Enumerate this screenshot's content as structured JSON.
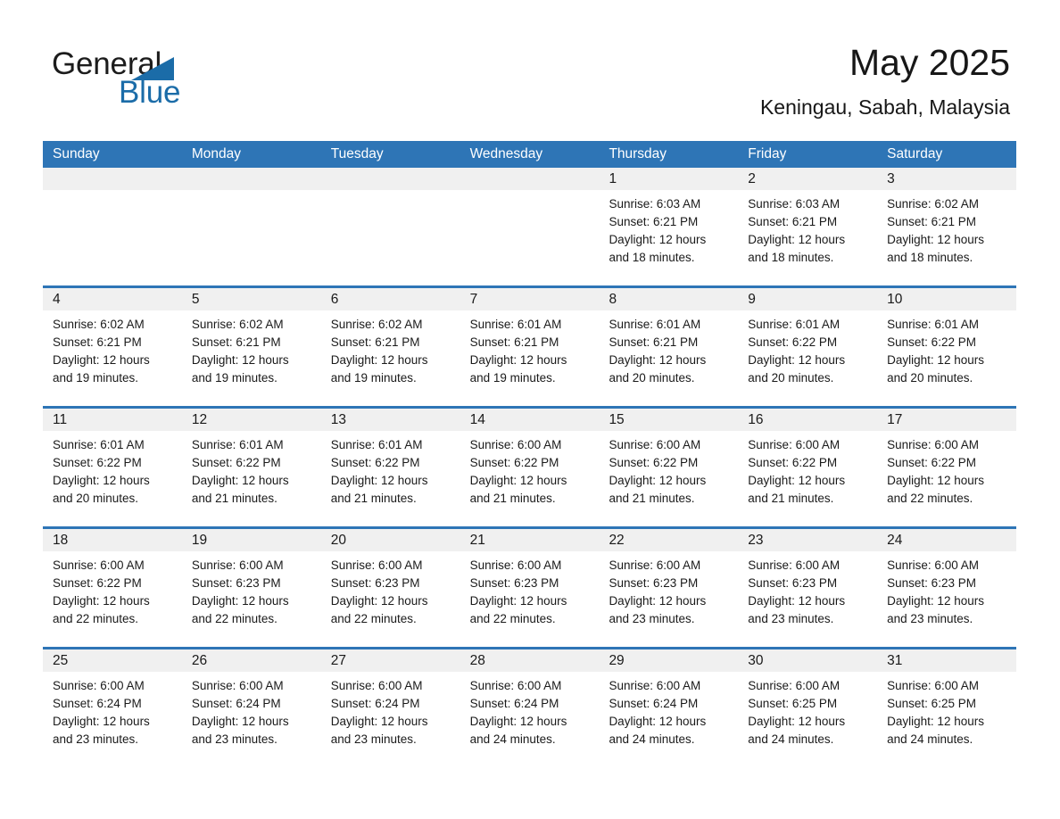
{
  "brand": {
    "line1": "General",
    "line2": "Blue",
    "triangle_color": "#1b6ca8"
  },
  "header": {
    "title": "May 2025",
    "subtitle": "Keningau, Sabah, Malaysia"
  },
  "theme": {
    "header_blue": "#2e75b6",
    "day_band_gray": "#f0f0f0",
    "cell_white": "#ffffff",
    "text": "#1a1a1a"
  },
  "weekdays": [
    "Sunday",
    "Monday",
    "Tuesday",
    "Wednesday",
    "Thursday",
    "Friday",
    "Saturday"
  ],
  "weeks": [
    [
      {
        "day": "",
        "empty": true
      },
      {
        "day": "",
        "empty": true
      },
      {
        "day": "",
        "empty": true
      },
      {
        "day": "",
        "empty": true
      },
      {
        "day": "1",
        "sunrise": "Sunrise: 6:03 AM",
        "sunset": "Sunset: 6:21 PM",
        "daylight1": "Daylight: 12 hours",
        "daylight2": "and 18 minutes."
      },
      {
        "day": "2",
        "sunrise": "Sunrise: 6:03 AM",
        "sunset": "Sunset: 6:21 PM",
        "daylight1": "Daylight: 12 hours",
        "daylight2": "and 18 minutes."
      },
      {
        "day": "3",
        "sunrise": "Sunrise: 6:02 AM",
        "sunset": "Sunset: 6:21 PM",
        "daylight1": "Daylight: 12 hours",
        "daylight2": "and 18 minutes."
      }
    ],
    [
      {
        "day": "4",
        "sunrise": "Sunrise: 6:02 AM",
        "sunset": "Sunset: 6:21 PM",
        "daylight1": "Daylight: 12 hours",
        "daylight2": "and 19 minutes."
      },
      {
        "day": "5",
        "sunrise": "Sunrise: 6:02 AM",
        "sunset": "Sunset: 6:21 PM",
        "daylight1": "Daylight: 12 hours",
        "daylight2": "and 19 minutes."
      },
      {
        "day": "6",
        "sunrise": "Sunrise: 6:02 AM",
        "sunset": "Sunset: 6:21 PM",
        "daylight1": "Daylight: 12 hours",
        "daylight2": "and 19 minutes."
      },
      {
        "day": "7",
        "sunrise": "Sunrise: 6:01 AM",
        "sunset": "Sunset: 6:21 PM",
        "daylight1": "Daylight: 12 hours",
        "daylight2": "and 19 minutes."
      },
      {
        "day": "8",
        "sunrise": "Sunrise: 6:01 AM",
        "sunset": "Sunset: 6:21 PM",
        "daylight1": "Daylight: 12 hours",
        "daylight2": "and 20 minutes."
      },
      {
        "day": "9",
        "sunrise": "Sunrise: 6:01 AM",
        "sunset": "Sunset: 6:22 PM",
        "daylight1": "Daylight: 12 hours",
        "daylight2": "and 20 minutes."
      },
      {
        "day": "10",
        "sunrise": "Sunrise: 6:01 AM",
        "sunset": "Sunset: 6:22 PM",
        "daylight1": "Daylight: 12 hours",
        "daylight2": "and 20 minutes."
      }
    ],
    [
      {
        "day": "11",
        "sunrise": "Sunrise: 6:01 AM",
        "sunset": "Sunset: 6:22 PM",
        "daylight1": "Daylight: 12 hours",
        "daylight2": "and 20 minutes."
      },
      {
        "day": "12",
        "sunrise": "Sunrise: 6:01 AM",
        "sunset": "Sunset: 6:22 PM",
        "daylight1": "Daylight: 12 hours",
        "daylight2": "and 21 minutes."
      },
      {
        "day": "13",
        "sunrise": "Sunrise: 6:01 AM",
        "sunset": "Sunset: 6:22 PM",
        "daylight1": "Daylight: 12 hours",
        "daylight2": "and 21 minutes."
      },
      {
        "day": "14",
        "sunrise": "Sunrise: 6:00 AM",
        "sunset": "Sunset: 6:22 PM",
        "daylight1": "Daylight: 12 hours",
        "daylight2": "and 21 minutes."
      },
      {
        "day": "15",
        "sunrise": "Sunrise: 6:00 AM",
        "sunset": "Sunset: 6:22 PM",
        "daylight1": "Daylight: 12 hours",
        "daylight2": "and 21 minutes."
      },
      {
        "day": "16",
        "sunrise": "Sunrise: 6:00 AM",
        "sunset": "Sunset: 6:22 PM",
        "daylight1": "Daylight: 12 hours",
        "daylight2": "and 21 minutes."
      },
      {
        "day": "17",
        "sunrise": "Sunrise: 6:00 AM",
        "sunset": "Sunset: 6:22 PM",
        "daylight1": "Daylight: 12 hours",
        "daylight2": "and 22 minutes."
      }
    ],
    [
      {
        "day": "18",
        "sunrise": "Sunrise: 6:00 AM",
        "sunset": "Sunset: 6:22 PM",
        "daylight1": "Daylight: 12 hours",
        "daylight2": "and 22 minutes."
      },
      {
        "day": "19",
        "sunrise": "Sunrise: 6:00 AM",
        "sunset": "Sunset: 6:23 PM",
        "daylight1": "Daylight: 12 hours",
        "daylight2": "and 22 minutes."
      },
      {
        "day": "20",
        "sunrise": "Sunrise: 6:00 AM",
        "sunset": "Sunset: 6:23 PM",
        "daylight1": "Daylight: 12 hours",
        "daylight2": "and 22 minutes."
      },
      {
        "day": "21",
        "sunrise": "Sunrise: 6:00 AM",
        "sunset": "Sunset: 6:23 PM",
        "daylight1": "Daylight: 12 hours",
        "daylight2": "and 22 minutes."
      },
      {
        "day": "22",
        "sunrise": "Sunrise: 6:00 AM",
        "sunset": "Sunset: 6:23 PM",
        "daylight1": "Daylight: 12 hours",
        "daylight2": "and 23 minutes."
      },
      {
        "day": "23",
        "sunrise": "Sunrise: 6:00 AM",
        "sunset": "Sunset: 6:23 PM",
        "daylight1": "Daylight: 12 hours",
        "daylight2": "and 23 minutes."
      },
      {
        "day": "24",
        "sunrise": "Sunrise: 6:00 AM",
        "sunset": "Sunset: 6:23 PM",
        "daylight1": "Daylight: 12 hours",
        "daylight2": "and 23 minutes."
      }
    ],
    [
      {
        "day": "25",
        "sunrise": "Sunrise: 6:00 AM",
        "sunset": "Sunset: 6:24 PM",
        "daylight1": "Daylight: 12 hours",
        "daylight2": "and 23 minutes."
      },
      {
        "day": "26",
        "sunrise": "Sunrise: 6:00 AM",
        "sunset": "Sunset: 6:24 PM",
        "daylight1": "Daylight: 12 hours",
        "daylight2": "and 23 minutes."
      },
      {
        "day": "27",
        "sunrise": "Sunrise: 6:00 AM",
        "sunset": "Sunset: 6:24 PM",
        "daylight1": "Daylight: 12 hours",
        "daylight2": "and 23 minutes."
      },
      {
        "day": "28",
        "sunrise": "Sunrise: 6:00 AM",
        "sunset": "Sunset: 6:24 PM",
        "daylight1": "Daylight: 12 hours",
        "daylight2": "and 24 minutes."
      },
      {
        "day": "29",
        "sunrise": "Sunrise: 6:00 AM",
        "sunset": "Sunset: 6:24 PM",
        "daylight1": "Daylight: 12 hours",
        "daylight2": "and 24 minutes."
      },
      {
        "day": "30",
        "sunrise": "Sunrise: 6:00 AM",
        "sunset": "Sunset: 6:25 PM",
        "daylight1": "Daylight: 12 hours",
        "daylight2": "and 24 minutes."
      },
      {
        "day": "31",
        "sunrise": "Sunrise: 6:00 AM",
        "sunset": "Sunset: 6:25 PM",
        "daylight1": "Daylight: 12 hours",
        "daylight2": "and 24 minutes."
      }
    ]
  ]
}
